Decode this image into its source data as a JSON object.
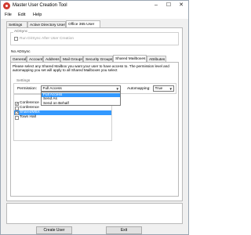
{
  "window": {
    "title": "Master User Creation Tool"
  },
  "controls": {
    "minimize": "–",
    "maximize": "☐",
    "close": "✕"
  },
  "menu": [
    "File",
    "Edit",
    "Help"
  ],
  "top_tabs": [
    "Settings",
    "Active Directory User",
    "Office 365 User"
  ],
  "adsync": {
    "group_label": "ADSync",
    "run_checkbox_label": "Run DirSync After User Creation",
    "run_checked": false
  },
  "no_adsync": {
    "label": "No ADSync"
  },
  "sub_tabs": [
    "General",
    "Account",
    "Address",
    "Mail Groups",
    "Security Groups",
    "Shared Mailboxes",
    "Attributes"
  ],
  "shared_mailboxes": {
    "description": "Please select any Shared Mailbox you want your user to have access to. The permission level and automapping you set will apply to all Shared Mailboxes you select",
    "settings_label": "Settings",
    "permission_label": "Permission:",
    "permission_value": "Full Access",
    "automapping_label": "Automapping:",
    "automapping_value": "True",
    "permission_options": [
      "Full Access",
      "Send As",
      "Send on Behalf"
    ],
    "permission_selected_index": 0,
    "mailboxes": [
      {
        "name": "Conference",
        "checked": true,
        "selected": false
      },
      {
        "name": "Conference",
        "checked": false,
        "selected": false
      },
      {
        "name": "SharedMBX",
        "checked": true,
        "selected": true
      },
      {
        "name": "Town Hall",
        "checked": false,
        "selected": false
      }
    ]
  },
  "buttons": {
    "create_user": "Create User",
    "exit": "Exit"
  }
}
